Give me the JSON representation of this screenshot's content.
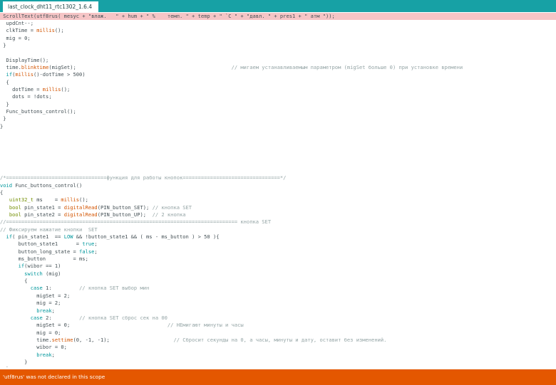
{
  "tabs": [
    {
      "label": "last_clock_dht11_rtc1302_1.6.4"
    }
  ],
  "status": {
    "message": "'utf8rus' was not declared in this scope"
  },
  "colors": {
    "tabbar": "#17a1a5",
    "status_bg": "#e45700",
    "error_line": "#f6c5c6",
    "keyword": "#00979c",
    "type": "#728e00",
    "function": "#d35400",
    "comment": "#95a5a6"
  },
  "code_lines": [
    {
      "error": true,
      "segs": [
        {
          "t": "tx",
          "v": " ScrollText(utf8rus( mesyc + \"влаж.   \" + hum + \" %    темп. \" + temp + \" `C \" + \"давл. \" + pres1 + \" атм \"));"
        }
      ]
    },
    {
      "segs": [
        {
          "t": "tx",
          "v": "  updCnt--;"
        }
      ]
    },
    {
      "segs": [
        {
          "t": "tx",
          "v": "  clkTime = "
        },
        {
          "t": "fn",
          "v": "millis"
        },
        {
          "t": "tx",
          "v": "();"
        }
      ]
    },
    {
      "segs": [
        {
          "t": "tx",
          "v": "  mig = 0;"
        }
      ]
    },
    {
      "segs": [
        {
          "t": "tx",
          "v": " }"
        }
      ]
    },
    {
      "segs": []
    },
    {
      "segs": [
        {
          "t": "tx",
          "v": "  DisplayTime();"
        }
      ]
    },
    {
      "segs": [
        {
          "t": "tx",
          "v": "  time."
        },
        {
          "t": "fn",
          "v": "blinktime"
        },
        {
          "t": "tx",
          "v": "(migSet);                                                   "
        },
        {
          "t": "cm",
          "v": "// мигаем устанавливаемым параметром (migSet больше 0) при установке времени"
        }
      ]
    },
    {
      "segs": [
        {
          "t": "tx",
          "v": "  "
        },
        {
          "t": "kw",
          "v": "if"
        },
        {
          "t": "tx",
          "v": "("
        },
        {
          "t": "fn",
          "v": "millis"
        },
        {
          "t": "tx",
          "v": "()-dotTime > 500)"
        }
      ]
    },
    {
      "segs": [
        {
          "t": "tx",
          "v": "  {"
        }
      ]
    },
    {
      "segs": [
        {
          "t": "tx",
          "v": "    dotTime = "
        },
        {
          "t": "fn",
          "v": "millis"
        },
        {
          "t": "tx",
          "v": "();"
        }
      ]
    },
    {
      "segs": [
        {
          "t": "tx",
          "v": "    dots = !dots;"
        }
      ]
    },
    {
      "segs": [
        {
          "t": "tx",
          "v": "  }"
        }
      ]
    },
    {
      "segs": [
        {
          "t": "tx",
          "v": "  Func_buttons_control();"
        }
      ]
    },
    {
      "segs": [
        {
          "t": "tx",
          "v": " }"
        }
      ]
    },
    {
      "segs": [
        {
          "t": "tx",
          "v": "}"
        }
      ]
    },
    {
      "segs": []
    },
    {
      "segs": []
    },
    {
      "segs": []
    },
    {
      "segs": []
    },
    {
      "segs": []
    },
    {
      "segs": []
    },
    {
      "segs": [
        {
          "t": "cm",
          "v": "/*=================================функция для работы кнопок================================*/"
        }
      ]
    },
    {
      "segs": [
        {
          "t": "kw",
          "v": "void"
        },
        {
          "t": "tx",
          "v": " Func_buttons_control()"
        }
      ]
    },
    {
      "segs": [
        {
          "t": "tx",
          "v": "{"
        }
      ]
    },
    {
      "segs": [
        {
          "t": "tx",
          "v": "   "
        },
        {
          "t": "kw2",
          "v": "uint32_t"
        },
        {
          "t": "tx",
          "v": " ms    = "
        },
        {
          "t": "fn",
          "v": "millis"
        },
        {
          "t": "tx",
          "v": "();"
        }
      ]
    },
    {
      "segs": [
        {
          "t": "tx",
          "v": "   "
        },
        {
          "t": "kw2",
          "v": "bool"
        },
        {
          "t": "tx",
          "v": " pin_state1 = "
        },
        {
          "t": "fn",
          "v": "digitalRead"
        },
        {
          "t": "tx",
          "v": "(PIN_button_SET); "
        },
        {
          "t": "cm",
          "v": "// кнопка SET"
        }
      ]
    },
    {
      "segs": [
        {
          "t": "tx",
          "v": "   "
        },
        {
          "t": "kw2",
          "v": "bool"
        },
        {
          "t": "tx",
          "v": " pin_state2 = "
        },
        {
          "t": "fn",
          "v": "digitalRead"
        },
        {
          "t": "tx",
          "v": "(PIN_button_UP);  "
        },
        {
          "t": "cm",
          "v": "// 2 кнопка"
        }
      ]
    },
    {
      "segs": [
        {
          "t": "cm",
          "v": "//============================================================================ кнопка SET"
        }
      ]
    },
    {
      "segs": [
        {
          "t": "cm",
          "v": "// Фиксируем нажатие кнопки  SET"
        }
      ]
    },
    {
      "segs": [
        {
          "t": "tx",
          "v": "  "
        },
        {
          "t": "kw",
          "v": "if"
        },
        {
          "t": "tx",
          "v": "( pin_state1  == "
        },
        {
          "t": "kw",
          "v": "LOW"
        },
        {
          "t": "tx",
          "v": " && !button_state1 && ( ms - ms_button ) > 50 ){"
        }
      ]
    },
    {
      "segs": [
        {
          "t": "tx",
          "v": "      button_state1      = "
        },
        {
          "t": "kw",
          "v": "true"
        },
        {
          "t": "tx",
          "v": ";"
        }
      ]
    },
    {
      "segs": [
        {
          "t": "tx",
          "v": "      button_long_state = "
        },
        {
          "t": "kw",
          "v": "false"
        },
        {
          "t": "tx",
          "v": ";"
        }
      ]
    },
    {
      "segs": [
        {
          "t": "tx",
          "v": "      ms_button         = ms;"
        }
      ]
    },
    {
      "segs": [
        {
          "t": "tx",
          "v": "      "
        },
        {
          "t": "kw",
          "v": "if"
        },
        {
          "t": "tx",
          "v": "(wibor == 1)"
        }
      ]
    },
    {
      "segs": [
        {
          "t": "tx",
          "v": "        "
        },
        {
          "t": "kw",
          "v": "switch"
        },
        {
          "t": "tx",
          "v": " (mig)"
        }
      ]
    },
    {
      "segs": [
        {
          "t": "tx",
          "v": "        {"
        }
      ]
    },
    {
      "segs": [
        {
          "t": "tx",
          "v": "          "
        },
        {
          "t": "kw",
          "v": "case"
        },
        {
          "t": "tx",
          "v": " 1:         "
        },
        {
          "t": "cm",
          "v": "// кнопка SET выбор мин"
        }
      ]
    },
    {
      "segs": [
        {
          "t": "tx",
          "v": "            migSet = 2;"
        }
      ]
    },
    {
      "segs": [
        {
          "t": "tx",
          "v": "            mig = 2;"
        }
      ]
    },
    {
      "segs": [
        {
          "t": "tx",
          "v": "            "
        },
        {
          "t": "kw",
          "v": "break"
        },
        {
          "t": "tx",
          "v": ";"
        }
      ]
    },
    {
      "segs": [
        {
          "t": "tx",
          "v": "          "
        },
        {
          "t": "kw",
          "v": "case"
        },
        {
          "t": "tx",
          "v": " 2:         "
        },
        {
          "t": "cm",
          "v": "// кнопка SET сброс сек на 00"
        }
      ]
    },
    {
      "segs": [
        {
          "t": "tx",
          "v": "            migSet = 0;                                "
        },
        {
          "t": "cm",
          "v": "// НЕмигают минуты и часы"
        }
      ]
    },
    {
      "segs": [
        {
          "t": "tx",
          "v": "            mig = 0;"
        }
      ]
    },
    {
      "segs": [
        {
          "t": "tx",
          "v": "            time."
        },
        {
          "t": "fn",
          "v": "settime"
        },
        {
          "t": "tx",
          "v": "(0, -1, -1);                     "
        },
        {
          "t": "cm",
          "v": "// Сбросит секунды на 0, а часы, минуты и дату, оставит без изменений."
        }
      ]
    },
    {
      "segs": [
        {
          "t": "tx",
          "v": "            wibor = 0;"
        }
      ]
    },
    {
      "segs": [
        {
          "t": "tx",
          "v": "            "
        },
        {
          "t": "kw",
          "v": "break"
        },
        {
          "t": "tx",
          "v": ";"
        }
      ]
    },
    {
      "segs": [
        {
          "t": "tx",
          "v": "        }"
        }
      ]
    },
    {
      "segs": [
        {
          "t": "tx",
          "v": "  }"
        }
      ]
    }
  ]
}
